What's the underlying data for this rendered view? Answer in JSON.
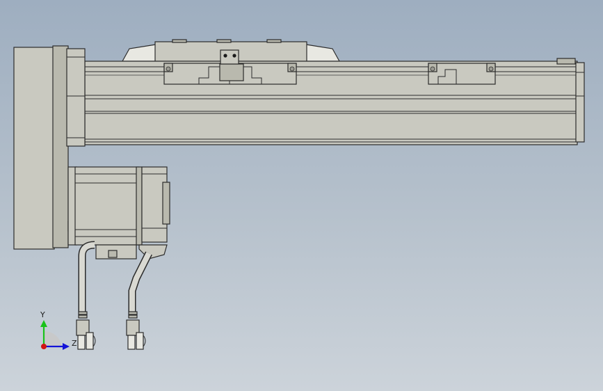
{
  "viewport": {
    "background_top": "#9eaec0",
    "background_bottom": "#ccd3da"
  },
  "model": {
    "name": "linear-actuator-with-motor",
    "part_color": "#c9c9c0",
    "edge_color": "#2b2b2b"
  },
  "triad": {
    "y_label": "Y",
    "z_label": "Z",
    "y_color": "#19c219",
    "z_color": "#1414d8",
    "x_color": "#d01414"
  }
}
